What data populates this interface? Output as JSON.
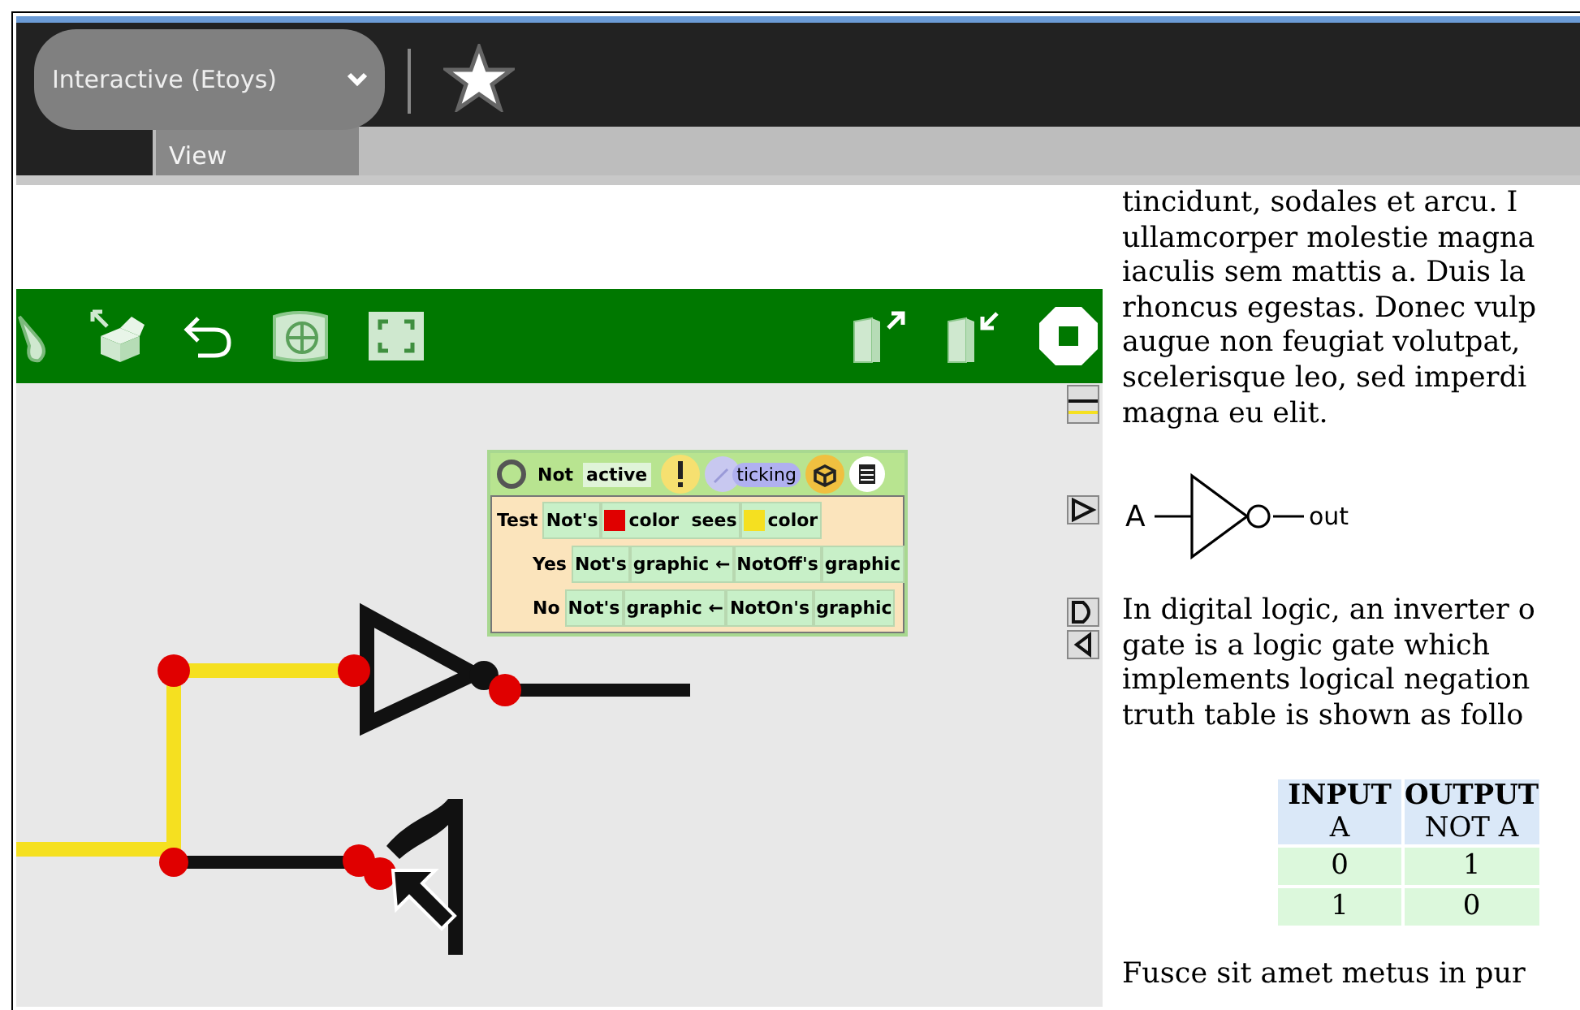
{
  "toolbar": {
    "activity_menu": "Interactive (Etoys)"
  },
  "tabs": [
    {
      "label": "View",
      "selected": true
    }
  ],
  "script": {
    "name": "Not",
    "status": "active",
    "ticking_label": "ticking",
    "rows": [
      {
        "label": "Test",
        "indent": false,
        "tiles": [
          {
            "text": "Not's"
          },
          {
            "text": "color  sees",
            "color": "#e00000"
          },
          {
            "text": "color",
            "color": "#f5e020"
          }
        ]
      },
      {
        "label": "Yes",
        "indent": true,
        "tiles": [
          {
            "text": "Not's"
          },
          {
            "text": "graphic ←"
          },
          {
            "text": "NotOff's"
          },
          {
            "text": "graphic"
          }
        ]
      },
      {
        "label": "No",
        "indent": true,
        "tiles": [
          {
            "text": "Not's"
          },
          {
            "text": "graphic ←"
          },
          {
            "text": "NotOn's"
          },
          {
            "text": "graphic"
          }
        ]
      }
    ]
  },
  "article": {
    "paragraph_1": [
      "tincidunt, sodales et arcu. I",
      "ullamcorper molestie magna",
      "iaculis sem mattis a. Duis la",
      "rhoncus egestas. Donec vulp",
      "augue non feugiat volutpat,",
      "scelerisque leo, sed imperdi",
      "magna eu elit."
    ],
    "figure": {
      "input_label": "A",
      "output_label": "out"
    },
    "paragraph_2": [
      "In digital logic, an inverter o",
      "gate is a logic gate which",
      "implements logical negation",
      "truth table is shown as follo"
    ],
    "truth_table": {
      "columns": [
        {
          "title": "INPUT",
          "subtitle": "A"
        },
        {
          "title": "OUTPUT",
          "subtitle": "NOT A"
        }
      ],
      "rows": [
        [
          "0",
          "1"
        ],
        [
          "1",
          "0"
        ]
      ]
    },
    "paragraph_3": "Fusce sit amet metus in pur"
  }
}
